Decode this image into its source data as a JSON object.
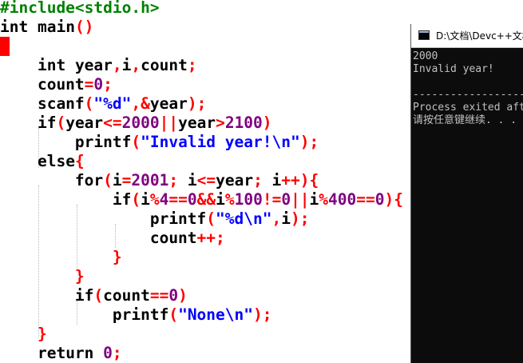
{
  "editor": {
    "lines": [
      [
        [
          "pre",
          "#include<stdio.h>"
        ]
      ],
      [
        [
          "kw",
          "int"
        ],
        [
          "t",
          " main"
        ],
        [
          "br",
          "()"
        ]
      ],
      [
        [
          "hl",
          "{"
        ]
      ],
      [
        [
          "t",
          "    "
        ],
        [
          "kw",
          "int"
        ],
        [
          "t",
          " year"
        ],
        [
          "op",
          ","
        ],
        [
          "t",
          "i"
        ],
        [
          "op",
          ","
        ],
        [
          "t",
          "count"
        ],
        [
          "op",
          ";"
        ]
      ],
      [
        [
          "t",
          "    count"
        ],
        [
          "op",
          "="
        ],
        [
          "num",
          "0"
        ],
        [
          "op",
          ";"
        ]
      ],
      [
        [
          "t",
          "    scanf"
        ],
        [
          "br",
          "("
        ],
        [
          "str",
          "\"%d\""
        ],
        [
          "op",
          ",&"
        ],
        [
          "t",
          "year"
        ],
        [
          "br",
          ")"
        ],
        [
          "op",
          ";"
        ]
      ],
      [
        [
          "t",
          "    "
        ],
        [
          "kw",
          "if"
        ],
        [
          "br",
          "("
        ],
        [
          "t",
          "year"
        ],
        [
          "op",
          "<="
        ],
        [
          "num",
          "2000"
        ],
        [
          "op",
          "||"
        ],
        [
          "t",
          "year"
        ],
        [
          "op",
          ">"
        ],
        [
          "num",
          "2100"
        ],
        [
          "br",
          ")"
        ]
      ],
      [
        [
          "t",
          "        printf"
        ],
        [
          "br",
          "("
        ],
        [
          "str",
          "\"Invalid year!\\n\""
        ],
        [
          "br",
          ")"
        ],
        [
          "op",
          ";"
        ]
      ],
      [
        [
          "t",
          "    "
        ],
        [
          "kw",
          "else"
        ],
        [
          "br",
          "{"
        ]
      ],
      [
        [
          "t",
          "        "
        ],
        [
          "kw",
          "for"
        ],
        [
          "br",
          "("
        ],
        [
          "t",
          "i"
        ],
        [
          "op",
          "="
        ],
        [
          "num",
          "2001"
        ],
        [
          "op",
          ";"
        ],
        [
          "t",
          " i"
        ],
        [
          "op",
          "<="
        ],
        [
          "t",
          "year"
        ],
        [
          "op",
          ";"
        ],
        [
          "t",
          " i"
        ],
        [
          "op",
          "++"
        ],
        [
          "br",
          "){"
        ]
      ],
      [
        [
          "t",
          "            "
        ],
        [
          "kw",
          "if"
        ],
        [
          "br",
          "("
        ],
        [
          "t",
          "i"
        ],
        [
          "op",
          "%"
        ],
        [
          "num",
          "4"
        ],
        [
          "op",
          "=="
        ],
        [
          "num",
          "0"
        ],
        [
          "op",
          "&&"
        ],
        [
          "t",
          "i"
        ],
        [
          "op",
          "%"
        ],
        [
          "num",
          "100"
        ],
        [
          "op",
          "!="
        ],
        [
          "num",
          "0"
        ],
        [
          "op",
          "||"
        ],
        [
          "t",
          "i"
        ],
        [
          "op",
          "%"
        ],
        [
          "num",
          "400"
        ],
        [
          "op",
          "=="
        ],
        [
          "num",
          "0"
        ],
        [
          "br",
          "){"
        ]
      ],
      [
        [
          "t",
          "                printf"
        ],
        [
          "br",
          "("
        ],
        [
          "str",
          "\"%d\\n\""
        ],
        [
          "op",
          ","
        ],
        [
          "t",
          "i"
        ],
        [
          "br",
          ")"
        ],
        [
          "op",
          ";"
        ]
      ],
      [
        [
          "t",
          "                count"
        ],
        [
          "op",
          "++;"
        ]
      ],
      [
        [
          "t",
          "            "
        ],
        [
          "br",
          "}"
        ]
      ],
      [
        [
          "t",
          "        "
        ],
        [
          "br",
          "}"
        ]
      ],
      [
        [
          "t",
          "        "
        ],
        [
          "kw",
          "if"
        ],
        [
          "br",
          "("
        ],
        [
          "t",
          "count"
        ],
        [
          "op",
          "=="
        ],
        [
          "num",
          "0"
        ],
        [
          "br",
          ")"
        ]
      ],
      [
        [
          "t",
          "            printf"
        ],
        [
          "br",
          "("
        ],
        [
          "str",
          "\"None\\n\""
        ],
        [
          "br",
          ")"
        ],
        [
          "op",
          ";"
        ]
      ],
      [
        [
          "t",
          "    "
        ],
        [
          "br",
          "}"
        ]
      ],
      [
        [
          "t",
          "    "
        ],
        [
          "kw",
          "return"
        ],
        [
          "t",
          " "
        ],
        [
          "num",
          "0"
        ],
        [
          "op",
          ";"
        ]
      ]
    ]
  },
  "console": {
    "title": "D:\\文档\\Devc++文档",
    "output": [
      "2000",
      "Invalid year!",
      "",
      "--------------------------------",
      "Process exited after",
      "请按任意键继续. . ."
    ]
  },
  "colors": {
    "keyword": "#000000",
    "operator": "#ff0000",
    "number": "#800080",
    "string": "#0000ff",
    "preprocessor": "#008000",
    "console_bg": "#0c0c0c",
    "console_text": "#c0c0c0"
  }
}
